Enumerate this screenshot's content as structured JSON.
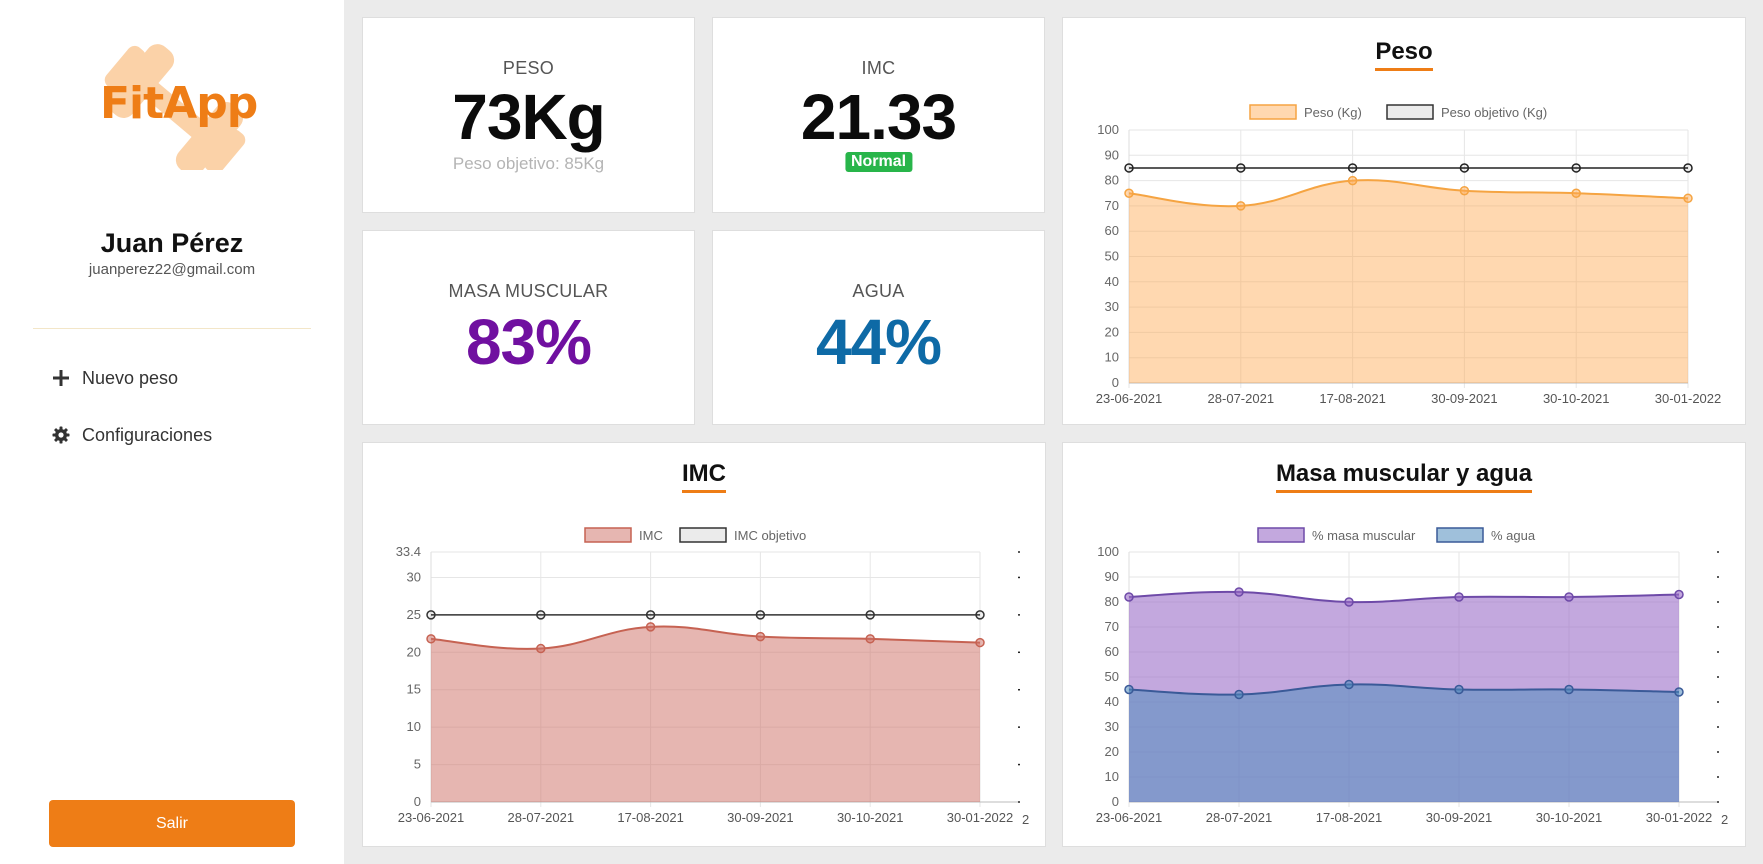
{
  "app": {
    "logo_text": "FitApp"
  },
  "user": {
    "name": "Juan Pérez",
    "email": "juanperez22@gmail.com"
  },
  "menu": [
    {
      "label": "Nuevo peso",
      "icon": "plus-icon"
    },
    {
      "label": "Configuraciones",
      "icon": "gear-icon"
    }
  ],
  "logout_label": "Salir",
  "stats": {
    "peso": {
      "label": "PESO",
      "value": "73Kg",
      "sub": "Peso objetivo: 85Kg"
    },
    "imc": {
      "label": "IMC",
      "value": "21.33",
      "badge": "Normal"
    },
    "masa": {
      "label": "MASA MUSCULAR",
      "value": "83%"
    },
    "agua": {
      "label": "AGUA",
      "value": "44%"
    }
  },
  "colors": {
    "accent": "#ee7d16",
    "masa": "#7010a0",
    "agua": "#0e6aa6",
    "badge": "#28b54a"
  },
  "chart_data": [
    {
      "id": "peso",
      "type": "area",
      "title": "Peso",
      "categories": [
        "23-06-2021",
        "28-07-2021",
        "17-08-2021",
        "30-09-2021",
        "30-10-2021",
        "30-01-2022"
      ],
      "series": [
        {
          "name": "Peso (Kg)",
          "values": [
            75,
            70,
            80,
            76,
            75,
            73
          ],
          "fill": "rgba(255,168,80,0.45)",
          "stroke": "#f5a442"
        },
        {
          "name": "Peso objetivo (Kg)",
          "values": [
            85,
            85,
            85,
            85,
            85,
            85
          ],
          "fill": "none",
          "stroke": "#222"
        }
      ],
      "ylim": [
        0,
        100
      ],
      "yticks": [
        "100",
        "90",
        "80",
        "70",
        "60",
        "50",
        "40",
        "30",
        "20",
        "10",
        "0"
      ],
      "grid": true,
      "legend": "top"
    },
    {
      "id": "imc",
      "type": "area",
      "title": "IMC",
      "categories": [
        "23-06-2021",
        "28-07-2021",
        "17-08-2021",
        "30-09-2021",
        "30-10-2021",
        "30-01-2022"
      ],
      "series": [
        {
          "name": "IMC",
          "values": [
            21.8,
            20.5,
            23.4,
            22.1,
            21.8,
            21.3
          ],
          "fill": "rgba(205,110,100,0.5)",
          "stroke": "#c66252"
        },
        {
          "name": "IMC objetivo",
          "values": [
            25,
            25,
            25,
            25,
            25,
            25
          ],
          "fill": "none",
          "stroke": "#333"
        }
      ],
      "ylim": [
        0,
        33.4
      ],
      "yticks": [
        "33.4",
        "30",
        "25",
        "20",
        "15",
        "10",
        "5",
        "0"
      ],
      "grid": true,
      "legend": "top",
      "extra_label": "2"
    },
    {
      "id": "masa-agua",
      "type": "area",
      "title": "Masa muscular y agua",
      "categories": [
        "23-06-2021",
        "28-07-2021",
        "17-08-2021",
        "30-09-2021",
        "30-10-2021",
        "30-01-2022"
      ],
      "series": [
        {
          "name": "% masa muscular",
          "values": [
            82,
            84,
            80,
            82,
            82,
            83
          ],
          "fill": "rgba(155,110,200,0.6)",
          "stroke": "#6e4aa8"
        },
        {
          "name": "% agua",
          "values": [
            45,
            43,
            47,
            45,
            45,
            44
          ],
          "fill": "rgba(80,140,190,0.55)",
          "stroke": "#3a5a98"
        }
      ],
      "ylim": [
        0,
        100
      ],
      "yticks": [
        "100",
        "90",
        "80",
        "70",
        "60",
        "50",
        "40",
        "30",
        "20",
        "10",
        "0"
      ],
      "grid": true,
      "legend": "top",
      "extra_label": "2"
    }
  ]
}
